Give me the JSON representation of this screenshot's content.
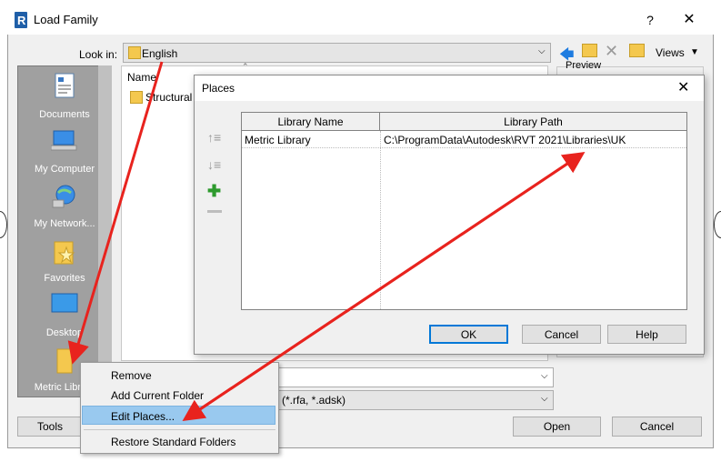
{
  "main_dialog": {
    "title": "Load Family",
    "help": "?",
    "close": "✕",
    "look_in_label": "Look in:",
    "look_in_value": "English",
    "views_label": "Views",
    "preview_label": "Preview",
    "places_bar": [
      {
        "label": "Documents",
        "icon": "documents-icon"
      },
      {
        "label": "My Computer",
        "icon": "computer-icon"
      },
      {
        "label": "My Network...",
        "icon": "network-icon"
      },
      {
        "label": "Favorites",
        "icon": "favorites-icon"
      },
      {
        "label": "Desktop",
        "icon": "desktop-icon"
      },
      {
        "label": "Metric Library",
        "icon": "folder-icon"
      }
    ],
    "file_list": {
      "column_name": "Name",
      "items": [
        "Structural"
      ]
    },
    "file_type_value": "(*.rfa, *.adsk)",
    "tools_label": "Tools",
    "open_label": "Open",
    "cancel_label": "Cancel"
  },
  "places_dialog": {
    "title": "Places",
    "close": "✕",
    "columns": [
      "Library Name",
      "Library Path"
    ],
    "rows": [
      {
        "name": "Metric Library",
        "path": "C:\\ProgramData\\Autodesk\\RVT 2021\\Libraries\\UK"
      }
    ],
    "ok_label": "OK",
    "cancel_label": "Cancel",
    "help_label": "Help"
  },
  "context_menu": {
    "items": [
      "Remove",
      "Add Current Folder",
      "Edit Places...",
      "Restore Standard Folders"
    ],
    "highlighted": "Edit Places..."
  },
  "colors": {
    "annotation_arrow": "#e8231e",
    "places_bar": "#a0a0a0",
    "menu_highlight": "#99c9ef",
    "accent": "#0078d7"
  }
}
